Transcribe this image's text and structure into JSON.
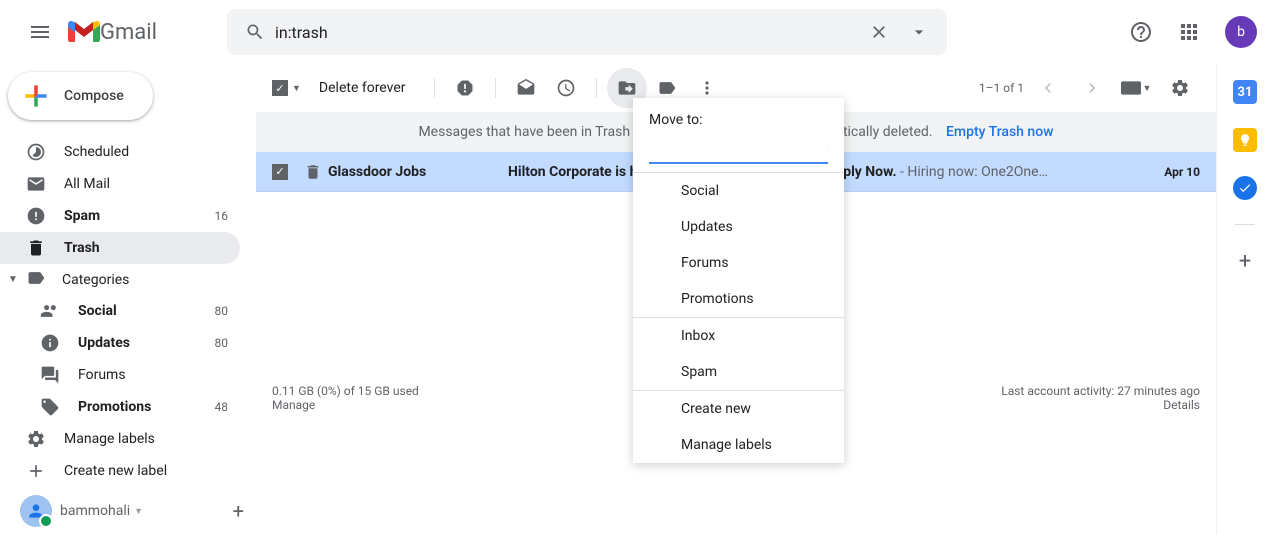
{
  "header": {
    "logo_text": "Gmail",
    "search_value": "in:trash",
    "avatar_letter": "b"
  },
  "sidebar": {
    "compose_label": "Compose",
    "items": [
      {
        "label": "Scheduled",
        "count": ""
      },
      {
        "label": "All Mail",
        "count": ""
      },
      {
        "label": "Spam",
        "count": "16"
      },
      {
        "label": "Trash",
        "count": ""
      },
      {
        "label": "Categories",
        "count": ""
      },
      {
        "label": "Social",
        "count": "80"
      },
      {
        "label": "Updates",
        "count": "80"
      },
      {
        "label": "Forums",
        "count": ""
      },
      {
        "label": "Promotions",
        "count": "48"
      },
      {
        "label": "Manage labels",
        "count": ""
      },
      {
        "label": "Create new label",
        "count": ""
      }
    ],
    "hangouts_name": "bammohali"
  },
  "toolbar": {
    "delete_forever": "Delete forever",
    "count_text": "1–1 of 1"
  },
  "banner": {
    "text": "Messages that have been in Trash more than 30 days will be automatically deleted.",
    "link": "Empty Trash now"
  },
  "email": {
    "sender": "Glassdoor Jobs",
    "subject": "Hilton Corporate is hiring — Team Member (India). Apply Now.",
    "snippet": " - Hiring now: One2One…",
    "date": "Apr 10"
  },
  "footer": {
    "storage": "0.11 GB (0%) of 15 GB used",
    "manage": "Manage",
    "activity": "Last account activity: 27 minutes ago",
    "details": "Details"
  },
  "popup": {
    "title": "Move to:",
    "options_a": [
      "Social",
      "Updates",
      "Forums",
      "Promotions"
    ],
    "options_b": [
      "Inbox",
      "Spam"
    ],
    "options_c": [
      "Create new",
      "Manage labels"
    ]
  }
}
